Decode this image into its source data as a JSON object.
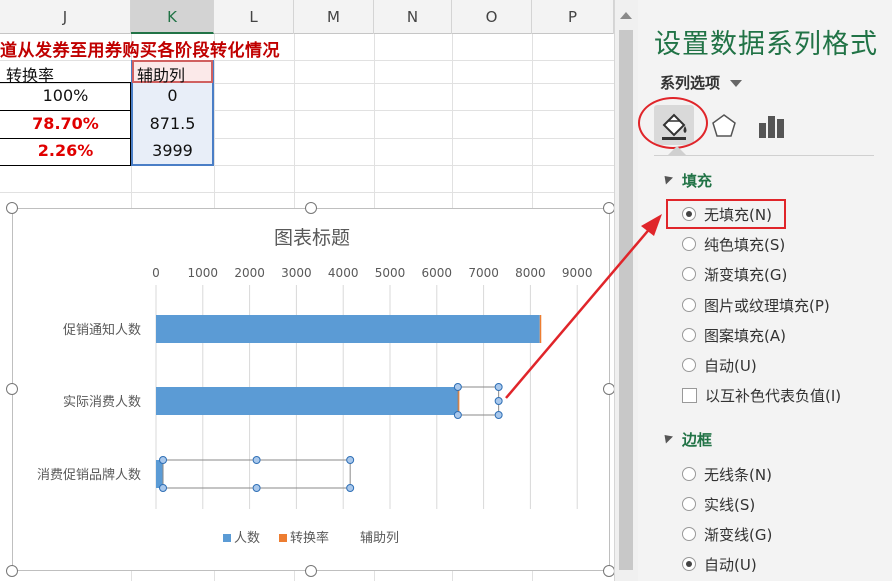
{
  "columns": [
    "J",
    "K",
    "L",
    "M",
    "N",
    "O",
    "P"
  ],
  "sheet": {
    "title": "道从发券至用券购买各阶段转化情况",
    "header_left": "转换率",
    "header_helper": "辅助列",
    "rows": [
      {
        "rate": "100%",
        "helper": "0"
      },
      {
        "rate": "78.70%",
        "helper": "871.5"
      },
      {
        "rate": "2.26%",
        "helper": "3999"
      }
    ]
  },
  "chart": {
    "title": "图表标题",
    "legend": [
      "人数",
      "转换率",
      "辅助列"
    ],
    "colors": {
      "people": "#5b9bd5",
      "rate": "#ed7d31",
      "helper": "none"
    }
  },
  "chart_data": {
    "type": "bar",
    "orientation": "horizontal",
    "stacked": true,
    "title": "图表标题",
    "categories": [
      "促销通知人数",
      "实际消费人数",
      "消费促销品牌人数"
    ],
    "xticks": [
      "0",
      "1000",
      "2000",
      "3000",
      "4000",
      "5000",
      "6000",
      "7000",
      "8000",
      "9000"
    ],
    "xlim": [
      0,
      9000
    ],
    "grid": true,
    "legend_position": "bottom",
    "series": [
      {
        "name": "人数",
        "values": [
          8200,
          6450,
          0
        ]
      },
      {
        "name": "转换率",
        "values": [
          1,
          0.787,
          0.0226
        ]
      },
      {
        "name": "辅助列",
        "values": [
          0,
          871.5,
          3999
        ]
      }
    ]
  },
  "pane": {
    "title": "设置数据系列格式",
    "series_options": "系列选项",
    "fill_section": "填充",
    "fill_options": [
      {
        "label": "无填充(N)",
        "selected": true
      },
      {
        "label": "纯色填充(S)",
        "selected": false
      },
      {
        "label": "渐变填充(G)",
        "selected": false
      },
      {
        "label": "图片或纹理填充(P)",
        "selected": false
      },
      {
        "label": "图案填充(A)",
        "selected": false
      },
      {
        "label": "自动(U)",
        "selected": false
      }
    ],
    "invert_label": "以互补色代表负值(I)",
    "border_section": "边框",
    "border_options": [
      {
        "label": "无线条(N)",
        "selected": false
      },
      {
        "label": "实线(S)",
        "selected": false
      },
      {
        "label": "渐变线(G)",
        "selected": false
      },
      {
        "label": "自动(U)",
        "selected": true
      }
    ]
  }
}
